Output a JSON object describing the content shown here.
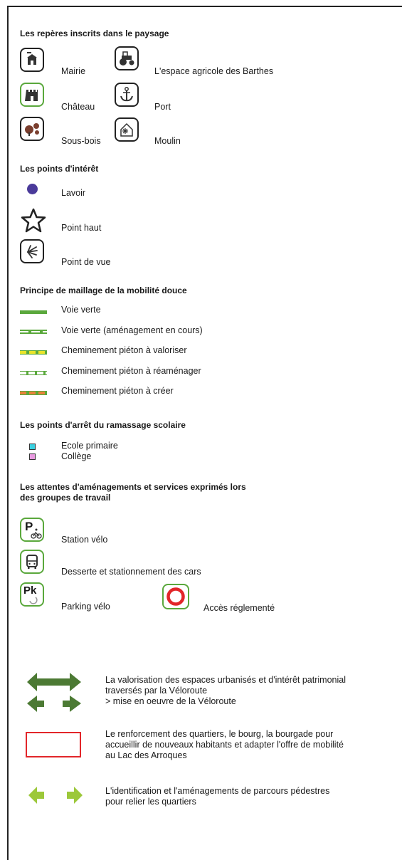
{
  "sections": {
    "reperes": {
      "title": "Les repères inscrits dans le paysage",
      "items": [
        "Mairie",
        "L'espace agricole des Barthes",
        "Château",
        "Port",
        "Sous-bois",
        "Moulin"
      ]
    },
    "interet": {
      "title": "Les points d'intérêt",
      "items": [
        "Lavoir",
        "Point haut",
        "Point de vue"
      ]
    },
    "mobilite": {
      "title": "Principe de maillage de la mobilité douce",
      "items": [
        "Voie verte",
        "Voie verte (aménagement en cours)",
        "Cheminement piéton à valoriser",
        "Cheminement piéton à réaménager",
        "Cheminement piéton à créer"
      ]
    },
    "scolaire": {
      "title": "Les points d'arrêt du ramassage scolaire",
      "items": [
        "Ecole primaire",
        "Collège"
      ]
    },
    "attentes": {
      "title_line1": "Les attentes d'aménagements et services exprimés lors",
      "title_line2": "des groupes de travail",
      "items": [
        "Station vélo",
        "Desserte et stationnement des cars",
        "Parking vélo",
        "Accès réglementé"
      ],
      "icon_text": {
        "p": "P",
        "pk": "Pk"
      }
    },
    "enjeux": {
      "valorisation": [
        "La valorisation des espaces urbanisés et d'intérêt patrimonial",
        "traversés par la Véloroute",
        "> mise en oeuvre de la Véloroute"
      ],
      "renforcement": [
        "Le renforcement des quartiers, le bourg, la bourgade pour",
        "accueillir de nouveaux habitants et adapter l'offre de mobilité",
        "au Lac des Arroques"
      ],
      "identification": [
        "L'identification et l'aménagements de parcours pédestres",
        "pour relier les quartiers"
      ]
    }
  },
  "colors": {
    "green_dark": "#4c7a34",
    "green_mid": "#5aa83c",
    "green_light": "#9cc83a",
    "yellow": "#e8e42a",
    "orange": "#e8823a",
    "red": "#e2262a",
    "purple": "#4a3a9a",
    "cyan": "#3ad0e0",
    "pink": "#e89ae0",
    "brown": "#7a3e2e"
  },
  "icons": [
    "mairie-icon",
    "tractor-icon",
    "castle-icon",
    "anchor-icon",
    "trees-icon",
    "mill-icon",
    "lavoir-dot-icon",
    "star-icon",
    "viewpoint-icon",
    "bike-station-icon",
    "bus-icon",
    "bike-parking-icon",
    "no-entry-icon",
    "double-arrow-icon",
    "red-rectangle-icon",
    "light-green-arrows-icon"
  ]
}
